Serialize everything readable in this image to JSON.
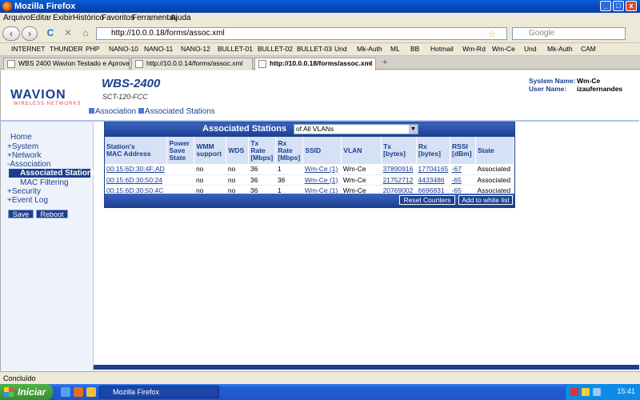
{
  "window": {
    "title": "Mozilla Firefox",
    "min": "_",
    "max": "□",
    "close": "x"
  },
  "menu": [
    "Arquivo",
    "Editar",
    "Exibir",
    "Histórico",
    "Favoritos",
    "Ferramentas",
    "Ajuda"
  ],
  "nav": {
    "url": "http://10.0.0.18/forms/assoc.xml",
    "search_placeholder": "Google",
    "back": "‹",
    "fwd": "›",
    "reload": "C",
    "stop": "✕",
    "home": "⌂",
    "star": "☆"
  },
  "bookmarks": [
    "INTERNET",
    "THUNDER",
    "PHP",
    "NANO-10",
    "NANO-11",
    "NANO-12",
    "BULLET-01",
    "BULLET-02",
    "BULLET-03",
    "Und",
    "Mk-Auth",
    "ML",
    "BB",
    "Hotmail",
    "Wm-Rd",
    "Wm-Ce",
    "Und",
    "Mk-Auth",
    "CAM"
  ],
  "tabs": [
    {
      "label": "WBS 2400 Wavion Testado e Aprovado"
    },
    {
      "label": "http://10.0.0.14/forms/assoc.xml"
    },
    {
      "label": "http://10.0.0.18/forms/assoc.xml"
    }
  ],
  "header": {
    "logo": "WAVION",
    "logo_sub": "WIRELESS NETWORKS",
    "product": "WBS-2400",
    "model": "SCT-120-FCC",
    "crumb1": "Association",
    "crumb2": "Associated Stations",
    "sys_label": "System Name:",
    "sys_value": "Wm-Ce",
    "user_label": "User Name:",
    "user_value": "izaufernandes"
  },
  "sidebar": {
    "home": "Home",
    "system": "+System",
    "network": "+Network",
    "association": "-Association",
    "assoc_stations": "Associated Stations",
    "mac_filtering": "MAC Filtering",
    "security": "+Security",
    "event_log": "+Event Log",
    "save": "Save",
    "reboot": "Reboot"
  },
  "panel": {
    "title": "Associated Stations",
    "vlan": "of All VLANs",
    "headers": [
      [
        "Station's",
        "MAC Address"
      ],
      [
        "Power",
        "Save",
        "State"
      ],
      [
        "WMM",
        "support"
      ],
      [
        "WDS"
      ],
      [
        "Tx",
        "Rate",
        "[Mbps]"
      ],
      [
        "Rx",
        "Rate",
        "[Mbps]"
      ],
      [
        "SSID"
      ],
      [
        "VLAN"
      ],
      [
        "Tx",
        "[bytes]"
      ],
      [
        "Rx",
        "[bytes]"
      ],
      [
        "RSSI",
        "[dBm]"
      ],
      [
        "State"
      ]
    ],
    "rows": [
      [
        "00:15:6D:30:4F:AD",
        "",
        "no",
        "no",
        "36",
        "1",
        "Wm-Ce (1)",
        "Wm-Ce",
        "37890916",
        "17704165",
        "-67",
        "Associated"
      ],
      [
        "00:15:6D:30:50:24",
        "",
        "no",
        "no",
        "36",
        "36",
        "Wm-Ce (1)",
        "Wm-Ce",
        "21752712",
        "4433486",
        "-65",
        "Associated"
      ],
      [
        "00:15:6D:30:50:4C",
        "",
        "no",
        "no",
        "36",
        "1",
        "Wm-Ce (1)",
        "Wm-Ce",
        "20769002",
        "6696831",
        "-65",
        "Associated"
      ]
    ],
    "reset_counters": "Reset Counters",
    "add_whitelist": "Add to white list"
  },
  "status": "Concluído",
  "taskbar": {
    "start": "Iniciar",
    "item": "Mozilla Firefox",
    "clock": "15:41"
  }
}
